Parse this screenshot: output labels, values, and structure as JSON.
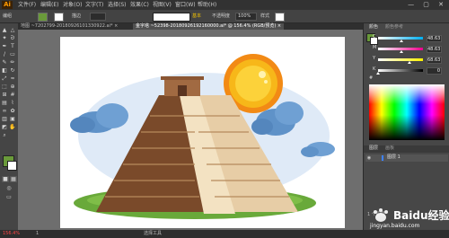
{
  "app": {
    "logo": "Ai"
  },
  "menu": {
    "items": [
      "文件(F)",
      "编辑(E)",
      "对象(O)",
      "文字(T)",
      "选择(S)",
      "效果(C)",
      "视图(V)",
      "窗口(W)",
      "帮助(H)"
    ]
  },
  "window_controls": "— ▢ ✕",
  "control_bar": {
    "selection_label": "编组",
    "stroke_label": "描边",
    "opacity_label": "不透明度",
    "opacity_value": "100%",
    "style_label": "样式",
    "basic_label": "基本"
  },
  "tabs": [
    {
      "label": "地图 ~7202799-20180926101330922.ai* ×",
      "active": false
    },
    {
      "label": "金字塔 ~52398-20180926192160000.ai* @ 156.4% (RGB/预览) ×",
      "active": true
    }
  ],
  "status": {
    "zoom": "156.4%",
    "page": "1",
    "tool": "选择工具"
  },
  "panel": {
    "tabs": [
      "颜色",
      "颜色参考"
    ],
    "channels": [
      {
        "label": "C",
        "value": "48.63",
        "fraction": 0.49
      },
      {
        "label": "M",
        "value": "48.63",
        "fraction": 0.49
      },
      {
        "label": "Y",
        "value": "68.63",
        "fraction": 0.69
      },
      {
        "label": "K",
        "value": "0",
        "fraction": 0.0
      }
    ],
    "hex_prefix": "#",
    "layers_tabs": [
      "图层",
      "画板"
    ],
    "layer_name": "图层 1",
    "layer_count": "1 个图层"
  },
  "watermark": {
    "text": "Baidu经验",
    "sub": "jingyan.baidu.com"
  },
  "colors": {
    "fill": "#6a9a3a",
    "sun": "#f7b719",
    "sun_rays": "#f28a15",
    "cloud": "#5f92c8",
    "cloud_light": "#dfeaf7",
    "grass": "#69a93a",
    "pyramid_dark": "#7a4a2a",
    "pyramid_mid": "#c9a27a",
    "pyramid_light": "#e7cda6",
    "pyramid_top": "#a16a42"
  }
}
